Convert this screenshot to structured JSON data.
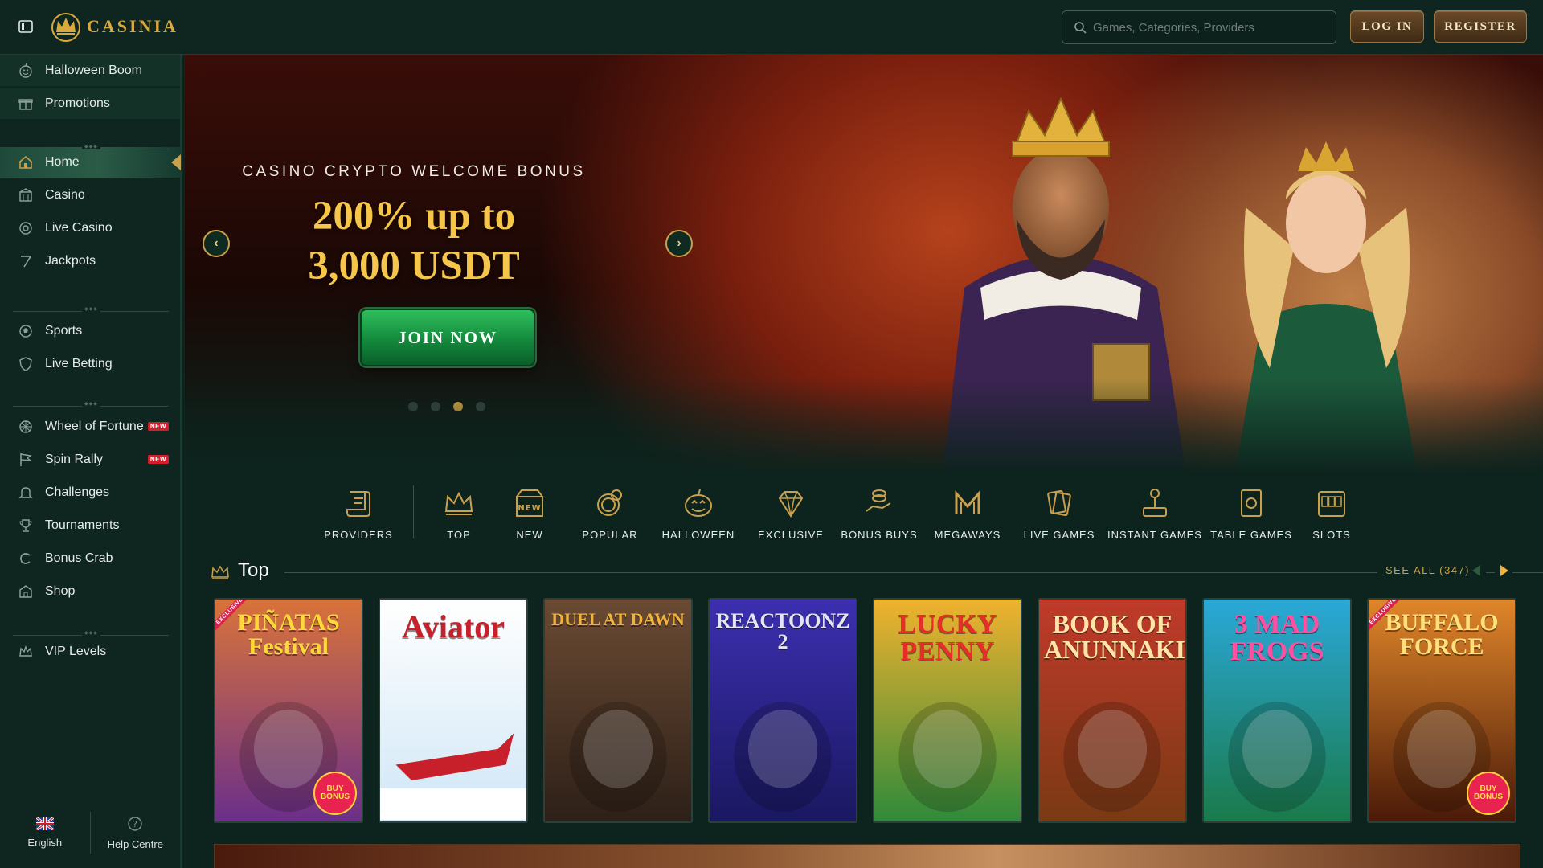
{
  "header": {
    "logo_text": "CASINIA",
    "search_placeholder": "Games, Categories, Providers",
    "login_label": "LOG IN",
    "register_label": "REGISTER"
  },
  "sidebar": {
    "top_items": [
      {
        "label": "Halloween Boom",
        "icon": "pumpkin-icon"
      },
      {
        "label": "Promotions",
        "icon": "gift-icon"
      }
    ],
    "main_items": [
      {
        "label": "Home",
        "icon": "home-icon",
        "active": true
      },
      {
        "label": "Casino",
        "icon": "casino-icon"
      },
      {
        "label": "Live Casino",
        "icon": "chip-icon"
      },
      {
        "label": "Jackpots",
        "icon": "seven-icon"
      }
    ],
    "sport_items": [
      {
        "label": "Sports",
        "icon": "ball-icon"
      },
      {
        "label": "Live Betting",
        "icon": "shield-icon"
      }
    ],
    "feature_items": [
      {
        "label": "Wheel of Fortune",
        "icon": "wheel-icon",
        "badge": "NEW"
      },
      {
        "label": "Spin Rally",
        "icon": "flag-icon",
        "badge": "NEW"
      },
      {
        "label": "Challenges",
        "icon": "bell-icon"
      },
      {
        "label": "Tournaments",
        "icon": "trophy-icon"
      },
      {
        "label": "Bonus Crab",
        "icon": "crab-icon"
      },
      {
        "label": "Shop",
        "icon": "shop-icon"
      }
    ],
    "vip_items": [
      {
        "label": "VIP Levels",
        "icon": "crown-icon"
      }
    ],
    "footer": {
      "language": "English",
      "help": "Help Centre"
    }
  },
  "hero": {
    "subtitle": "CASINO CRYPTO WELCOME BONUS",
    "title_line1": "200% up to",
    "title_line2": "3,000 USDT",
    "cta": "JOIN NOW",
    "slides": 4,
    "active_slide": 3
  },
  "categories": [
    {
      "label": "PROVIDERS",
      "icon": "scroll-icon"
    },
    {
      "label": "TOP",
      "icon": "crown-icon"
    },
    {
      "label": "NEW",
      "icon": "new-box-icon"
    },
    {
      "label": "POPULAR",
      "icon": "coins-icon"
    },
    {
      "label": "HALLOWEEN",
      "icon": "pumpkin-icon"
    },
    {
      "label": "EXCLUSIVE",
      "icon": "diamond-icon"
    },
    {
      "label": "BONUS BUYS",
      "icon": "hand-coins-icon"
    },
    {
      "label": "MEGAWAYS",
      "icon": "megaways-icon"
    },
    {
      "label": "LIVE GAMES",
      "icon": "cards-icon"
    },
    {
      "label": "INSTANT GAMES",
      "icon": "joystick-icon"
    },
    {
      "label": "TABLE GAMES",
      "icon": "table-icon"
    },
    {
      "label": "SLOTS",
      "icon": "slot-icon"
    }
  ],
  "top_section": {
    "title": "Top",
    "see_all": "SEE ALL (347)"
  },
  "games": [
    {
      "title": "PIÑATAS Festival",
      "bg": "#d9733a",
      "bg2": "#6b2f8a",
      "color": "#ffd83a",
      "exclusive": true,
      "bonus": true
    },
    {
      "title": "Aviator",
      "bg": "#ffffff",
      "bg2": "#cfe6f6",
      "color": "#c8202a",
      "exclusive": false,
      "bonus": false
    },
    {
      "title": "DUEL AT DAWN",
      "bg": "#6a4a33",
      "bg2": "#2d2018",
      "color": "#f2b33b",
      "exclusive": false,
      "bonus": false
    },
    {
      "title": "REACTOONZ 2",
      "bg": "#3c2fb0",
      "bg2": "#1a1860",
      "color": "#e5e5f2",
      "exclusive": false,
      "bonus": false
    },
    {
      "title": "LUCKY PENNY",
      "bg": "#f0b22e",
      "bg2": "#2f8a3a",
      "color": "#e82b2b",
      "exclusive": false,
      "bonus": false
    },
    {
      "title": "BOOK OF ANUNNAKI",
      "bg": "#c03a2a",
      "bg2": "#7a3a14",
      "color": "#ffe5a8",
      "exclusive": false,
      "bonus": false
    },
    {
      "title": "3 MAD FROGS",
      "bg": "#2aa8d8",
      "bg2": "#1a7a4a",
      "color": "#ff4fa0",
      "exclusive": false,
      "bonus": false
    },
    {
      "title": "BUFFALO FORCE",
      "bg": "#e0862a",
      "bg2": "#4a1a08",
      "color": "#ffe07a",
      "exclusive": true,
      "bonus": true
    }
  ],
  "game_badges": {
    "exclusive": "EXCLUSIVE",
    "bonus": "BUY BONUS"
  },
  "colors": {
    "accent_gold": "#c9a14e",
    "bg": "#0d231d",
    "sidebar_bg": "#0f2620",
    "cta_green": "#12843a",
    "new_badge": "#d11f2e"
  }
}
